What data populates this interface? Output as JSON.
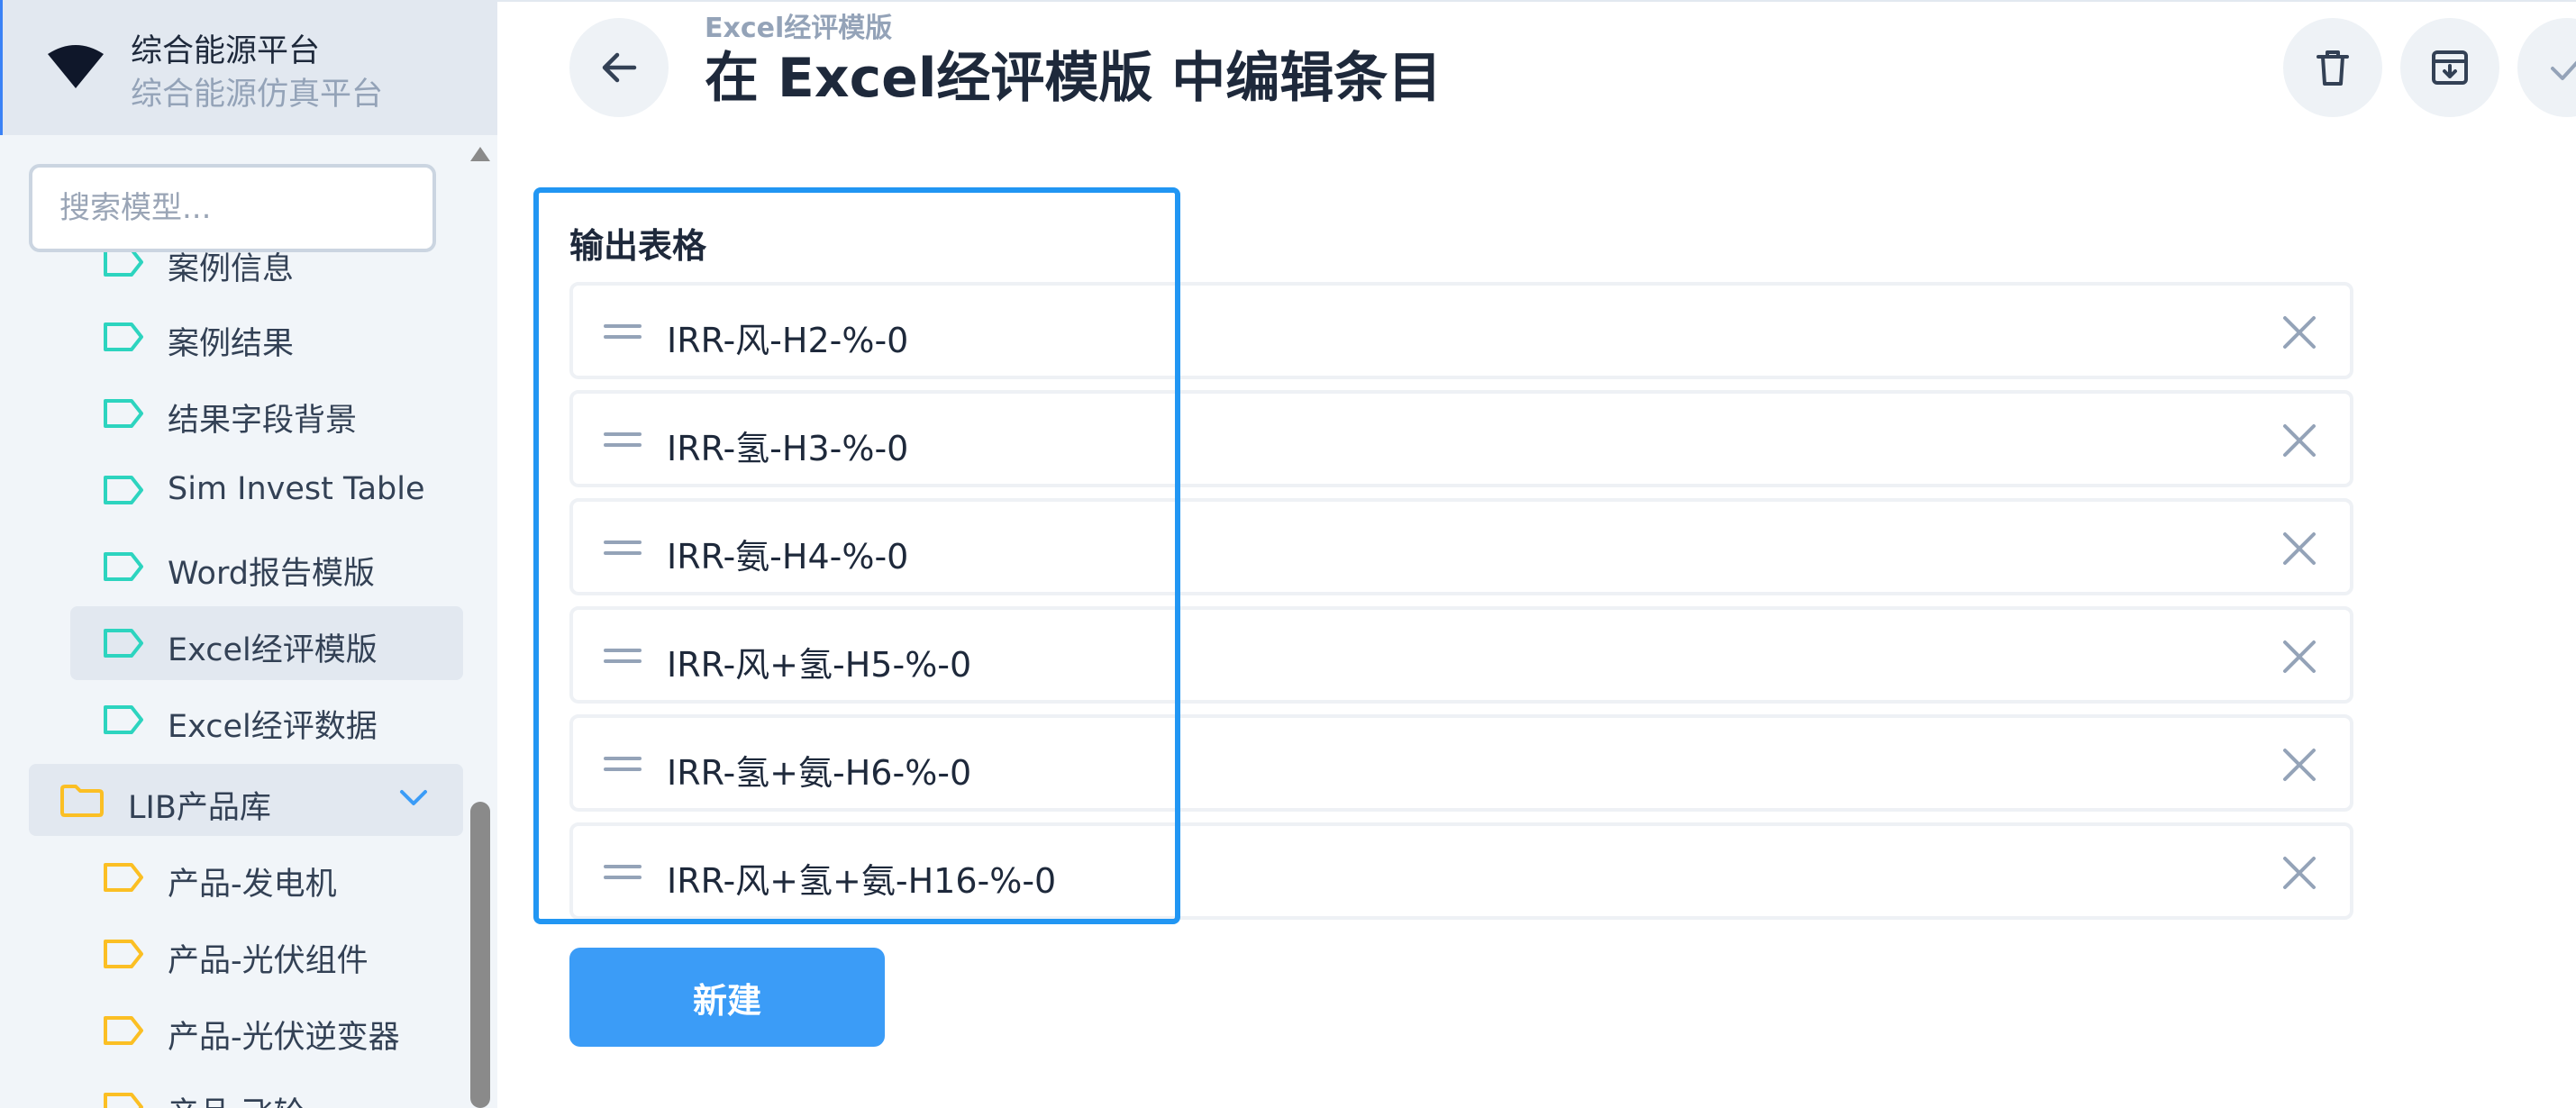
{
  "app": {
    "title": "综合能源平台",
    "subtitle": "综合能源仿真平台"
  },
  "search": {
    "placeholder": "搜索模型..."
  },
  "sidebar": {
    "items": [
      {
        "label": "案例信息",
        "color": "#2dd4bf",
        "active": false
      },
      {
        "label": "案例结果",
        "color": "#2dd4bf",
        "active": false
      },
      {
        "label": "结果字段背景",
        "color": "#2dd4bf",
        "active": false
      },
      {
        "label": "Sim Invest Table",
        "color": "#2dd4bf",
        "active": false
      },
      {
        "label": "Word报告模版",
        "color": "#2dd4bf",
        "active": false
      },
      {
        "label": "Excel经评模版",
        "color": "#2dd4bf",
        "active": true
      },
      {
        "label": "Excel经评数据",
        "color": "#2dd4bf",
        "active": false
      }
    ],
    "folder": {
      "label": "LIB产品库",
      "icon": "folder-icon",
      "expanded": true
    },
    "folder_items": [
      {
        "label": "产品-发电机",
        "color": "#fbbf24"
      },
      {
        "label": "产品-光伏组件",
        "color": "#fbbf24"
      },
      {
        "label": "产品-光伏逆变器",
        "color": "#fbbf24"
      },
      {
        "label": "产品-飞轮",
        "color": "#fbbf24"
      }
    ]
  },
  "header": {
    "breadcrumb": "Excel经评模版",
    "title": "在 Excel经评模版 中编辑条目",
    "actions": [
      "trash-icon",
      "archive-download-icon",
      "check-icon"
    ]
  },
  "main": {
    "section_label": "输出表格",
    "rows": [
      "IRR-风-H2-%-0",
      "IRR-氢-H3-%-0",
      "IRR-氨-H4-%-0",
      "IRR-风+氢-H5-%-0",
      "IRR-氢+氨-H6-%-0",
      "IRR-风+氢+氨-H16-%-0"
    ],
    "new_button": "新建"
  },
  "colors": {
    "accent": "#3b9cf7",
    "highlight": "#2196f3",
    "teal_tag": "#2dd4bf",
    "yellow_tag": "#fbbf24"
  }
}
